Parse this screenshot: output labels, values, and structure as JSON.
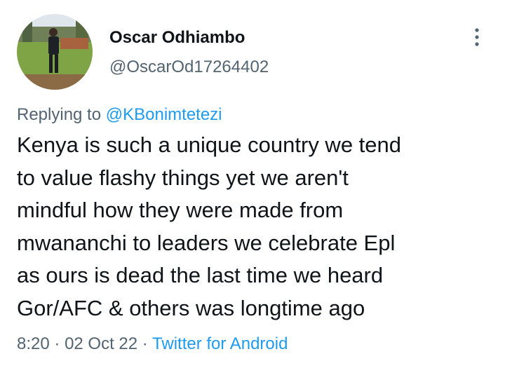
{
  "author": {
    "display_name": "Oscar Odhiambo",
    "handle": "@OscarOd17264402",
    "avatar_icon": "profile-photo"
  },
  "reply": {
    "prefix": "Replying to",
    "mention": "@KBonimtetezi"
  },
  "tweet": {
    "lines": [
      "Kenya is such a unique country we tend",
      "to value flashy things yet we aren't",
      "mindful how they were made from",
      "mwananchi to leaders we celebrate Epl",
      "as ours is dead the last time we heard",
      "Gor/AFC & others was longtime ago"
    ]
  },
  "meta": {
    "time": "8:20",
    "separator": "·",
    "date": "02 Oct 22",
    "source": "Twitter for Android"
  },
  "menu": {
    "icon": "more-vertical-icon"
  },
  "colors": {
    "text": "#0f1419",
    "secondary": "#536471",
    "accent": "#1d9bf0"
  }
}
